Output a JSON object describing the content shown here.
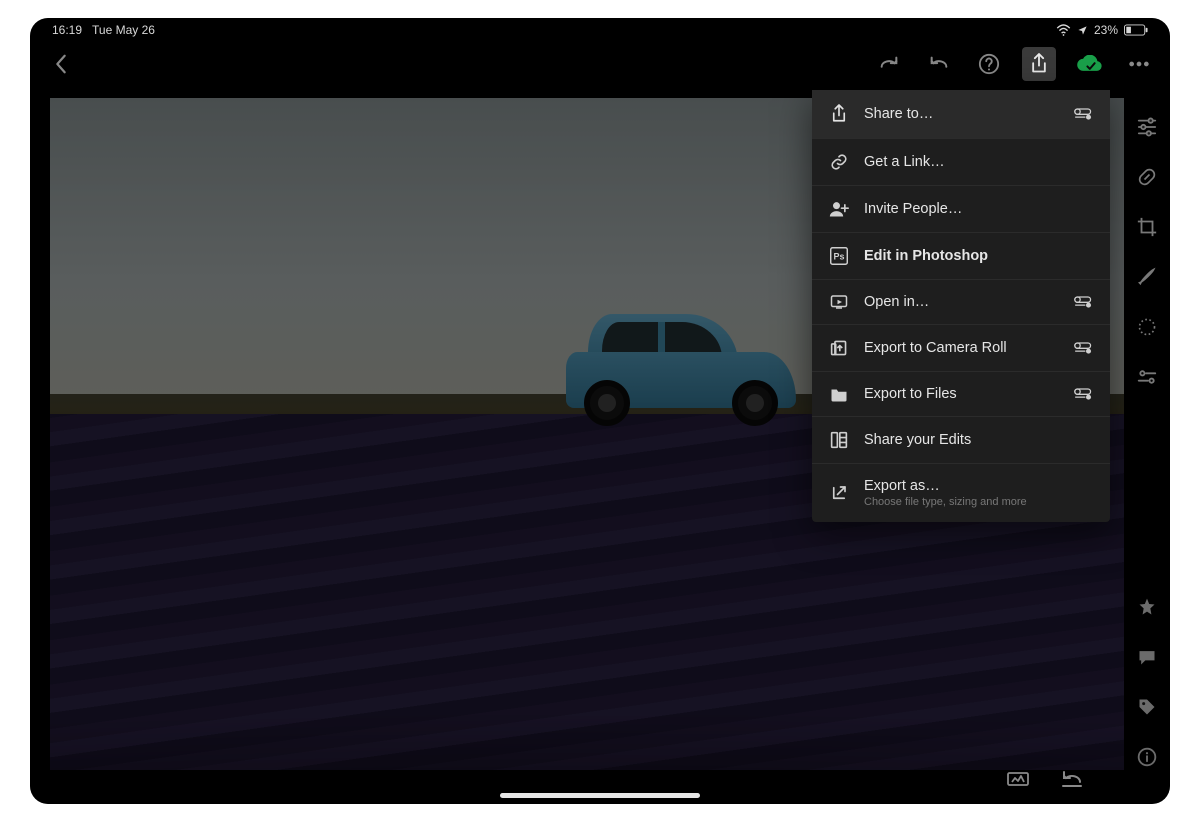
{
  "statusbar": {
    "time": "16:19",
    "date": "Tue May 26",
    "battery": "23%"
  },
  "toolbar": {
    "back": "Back"
  },
  "menu": {
    "share_to": "Share to…",
    "get_link": "Get a Link…",
    "invite": "Invite People…",
    "edit_ps": "Edit in Photoshop",
    "open_in": "Open in…",
    "export_roll": "Export to Camera Roll",
    "export_files": "Export to Files",
    "share_edits": "Share your Edits",
    "export_as": "Export as…",
    "export_as_sub": "Choose file type, sizing and more"
  }
}
